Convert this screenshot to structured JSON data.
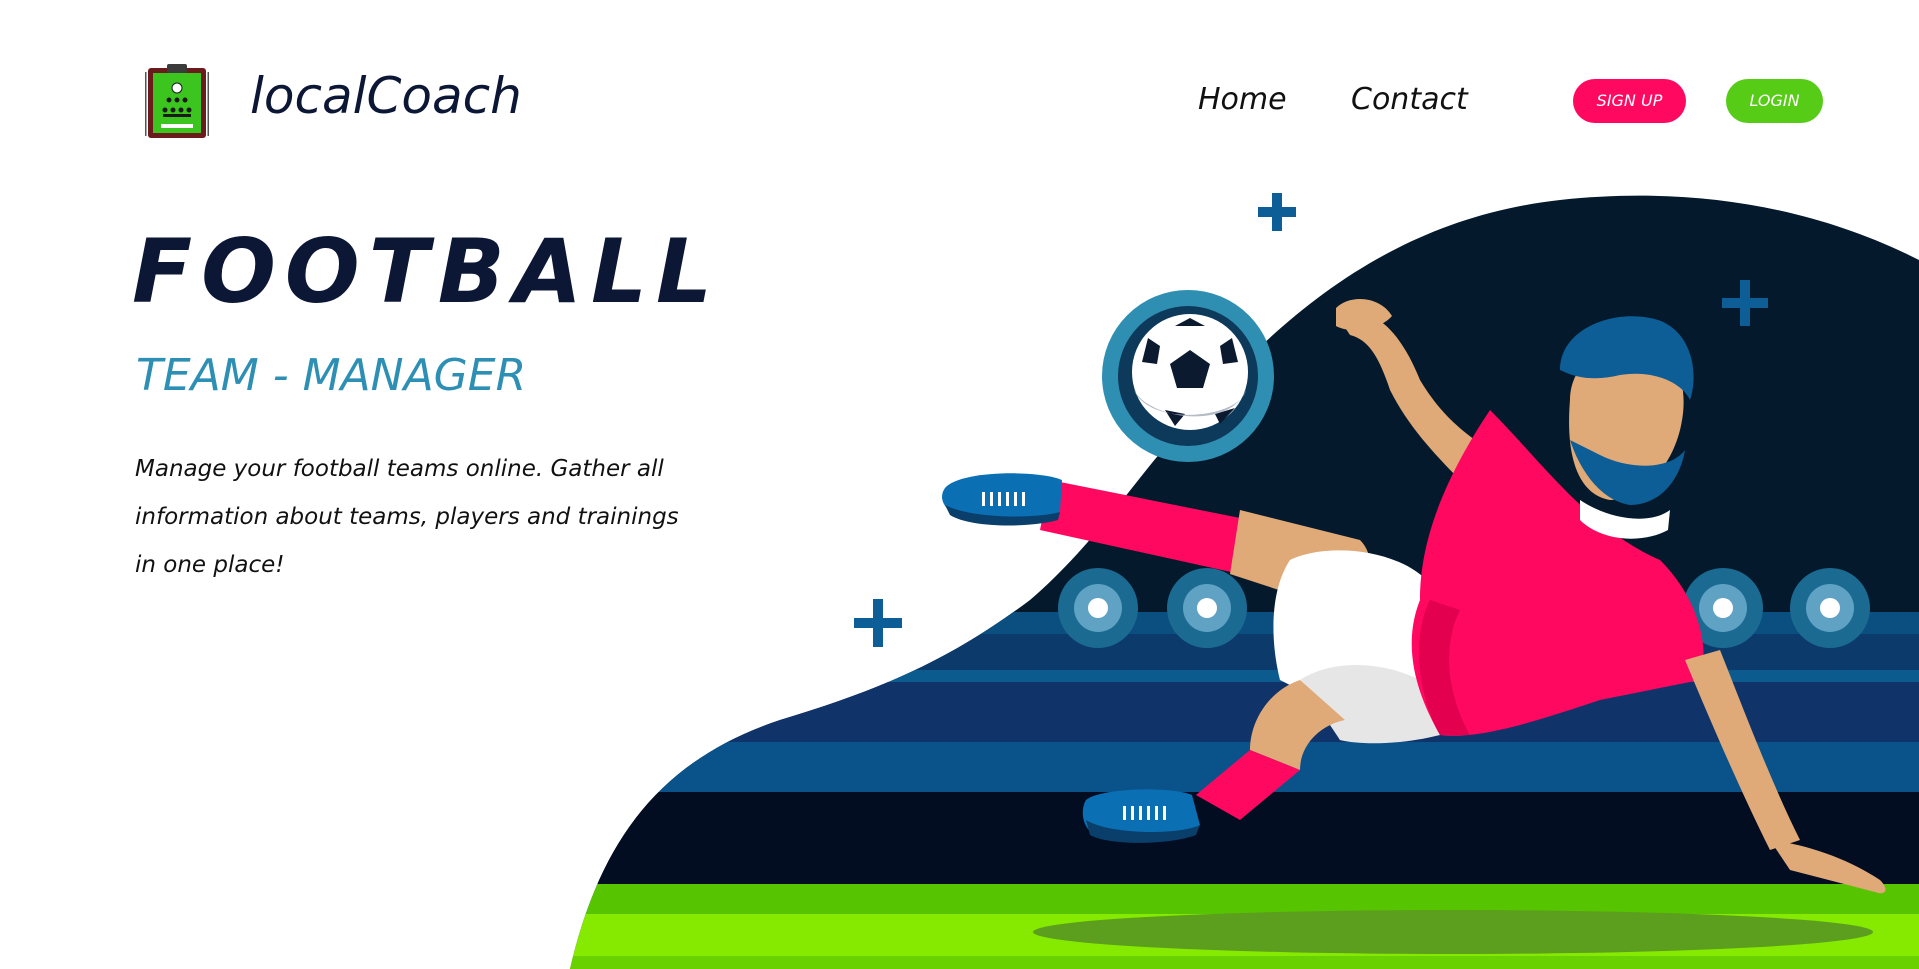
{
  "header": {
    "brand": "localCoach",
    "nav": [
      {
        "label": "Home"
      },
      {
        "label": "Contact"
      }
    ],
    "signup_label": "SIGN UP",
    "login_label": "LOGIN"
  },
  "hero": {
    "title": "FOOTBALL",
    "subtitle": "TEAM - MANAGER",
    "description_lines": [
      "Manage your football teams online. Gather all",
      "information about teams, players and trainings",
      "in one place!"
    ],
    "illustration": "football-player-kicking-ball"
  },
  "colors": {
    "navy": "#0c1736",
    "accent_blue": "#2e8fb4",
    "signup_pink": "#ff0860",
    "login_green": "#56cc16",
    "jersey_pink": "#ff0860",
    "pitch_green": "#7ee600",
    "stadium_dark": "#041a2c"
  }
}
